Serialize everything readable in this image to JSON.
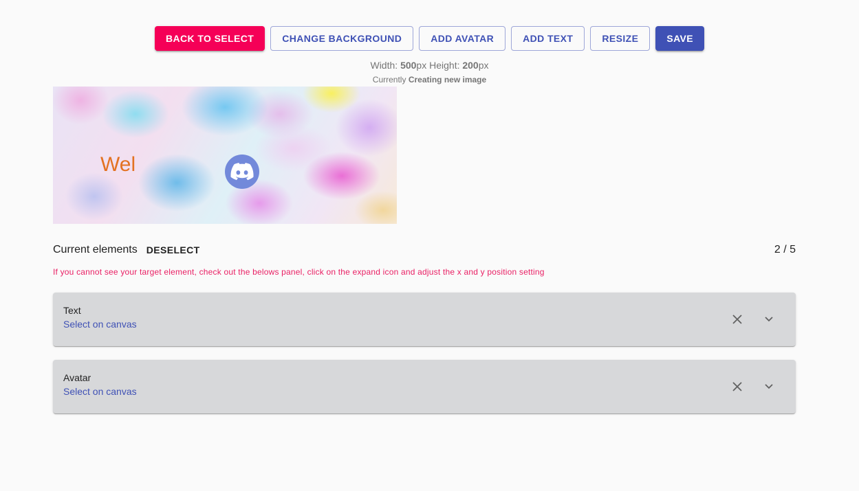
{
  "toolbar": {
    "back_label": "Back to select",
    "change_bg_label": "Change background",
    "add_avatar_label": "Add avatar",
    "add_text_label": "Add text",
    "resize_label": "Resize",
    "save_label": "Save"
  },
  "dims": {
    "width_label": "Width: ",
    "width_value": "500",
    "width_unit": "px",
    "height_label": " Height: ",
    "height_value": "200",
    "height_unit": "px"
  },
  "status": {
    "prefix": "Currently ",
    "value": "Creating new image"
  },
  "canvas": {
    "text": "Wel",
    "text_color": "#e37222",
    "avatar_icon": "discord-logo-icon",
    "avatar_color": "#7289da"
  },
  "elements": {
    "title": "Current elements",
    "deselect_label": "Deselect",
    "count": "2 / 5",
    "hint": "If you cannot see your target element, check out the belows panel, click on the expand icon and adjust the x and y position setting"
  },
  "panels": [
    {
      "title": "Text",
      "subtitle": "Select on canvas"
    },
    {
      "title": "Avatar",
      "subtitle": "Select on canvas"
    }
  ],
  "colors": {
    "primary": "#3f51b5",
    "secondary": "#f50057",
    "hint": "#e91e63",
    "panel_bg": "#d7d8da",
    "page_bg": "#fafafa"
  }
}
